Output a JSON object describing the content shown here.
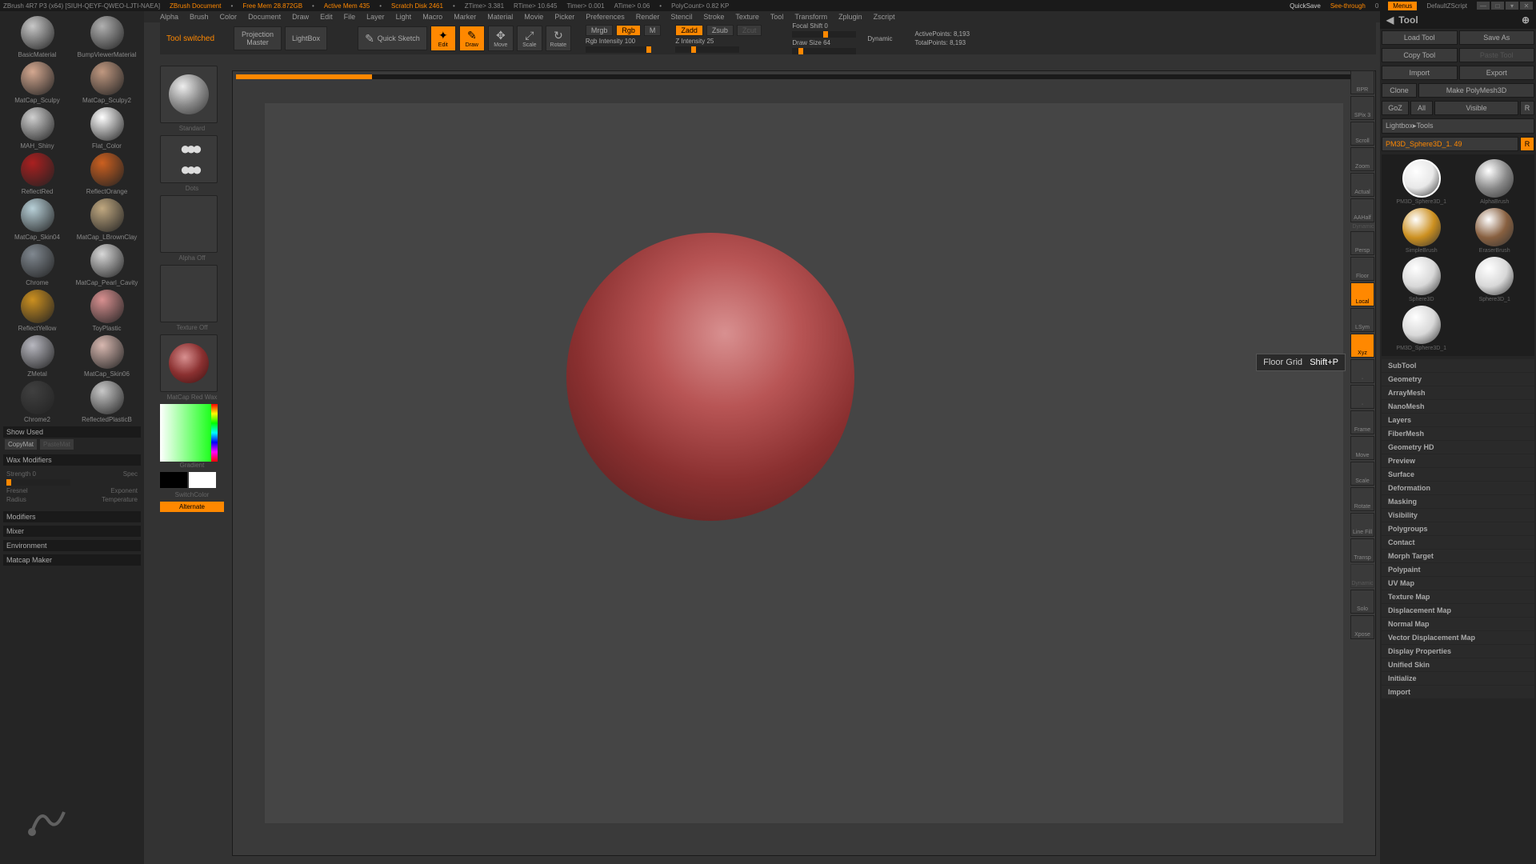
{
  "title_bar": {
    "app": "ZBrush 4R7 P3 (x64) [SIUH-QEYF-QWEO-LJTI-NAEA]",
    "doc": "ZBrush Document",
    "free_mem": "Free Mem 28.872GB",
    "active_mem": "Active Mem 435",
    "scratch": "Scratch Disk 2461",
    "ztime": "ZTime> 3.381",
    "rtime": "RTime> 10.645",
    "timer": "Timer> 0.001",
    "atime": "ATime> 0.06",
    "polycount": "PolyCount> 0.82 KP",
    "quicksave": "QuickSave",
    "seethrough": "See-through",
    "seethrough_val": "0",
    "menus": "Menus",
    "default_script": "DefaultZScript"
  },
  "menu": [
    "Alpha",
    "Brush",
    "Color",
    "Document",
    "Draw",
    "Edit",
    "File",
    "Layer",
    "Light",
    "Macro",
    "Marker",
    "Material",
    "Movie",
    "Picker",
    "Preferences",
    "Render",
    "Stencil",
    "Stroke",
    "Texture",
    "Tool",
    "Transform",
    "Zplugin",
    "Zscript"
  ],
  "toolbar": {
    "status": "Tool switched",
    "projection": "Projection Master",
    "lightbox": "LightBox",
    "quick_sketch": "Quick Sketch",
    "edit": "Edit",
    "draw": "Draw",
    "move": "Move",
    "scale": "Scale",
    "rotate": "Rotate",
    "mrgb": "Mrgb",
    "rgb": "Rgb",
    "m": "M",
    "rgb_intensity": "Rgb Intensity 100",
    "zadd": "Zadd",
    "zsub": "Zsub",
    "zcut": "Zcut",
    "z_intensity": "Z Intensity 25",
    "focal_shift": "Focal Shift 0",
    "draw_size": "Draw Size 64",
    "dynamic": "Dynamic",
    "active_points": "ActivePoints: 8,193",
    "total_points": "TotalPoints: 8,193"
  },
  "materials": [
    {
      "name": "BasicMaterial",
      "color": "#c8c8c8"
    },
    {
      "name": "BumpViewerMaterial",
      "color": "#b0b0b0"
    },
    {
      "name": "MatCap_Sculpy",
      "color": "#d4a890"
    },
    {
      "name": "MatCap_Sculpy2",
      "color": "#c09880"
    },
    {
      "name": "MAH_Shiny",
      "color": "#d0d0d0"
    },
    {
      "name": "Flat_Color",
      "color": "#ffffff"
    },
    {
      "name": "ReflectRed",
      "color": "#aa2020"
    },
    {
      "name": "ReflectOrange",
      "color": "#cc6020"
    },
    {
      "name": "MatCap_Skin04",
      "color": "#b8d0d8"
    },
    {
      "name": "MatCap_LBrownClay",
      "color": "#c0a880"
    },
    {
      "name": "Chrome",
      "color": "#808890"
    },
    {
      "name": "MatCap_Pearl_Cavity",
      "color": "#d8d8d8"
    },
    {
      "name": "ReflectYellow",
      "color": "#cc9020"
    },
    {
      "name": "ToyPlastic",
      "color": "#d89090"
    },
    {
      "name": "ZMetal",
      "color": "#b8b8c0"
    },
    {
      "name": "MatCap_Skin06",
      "color": "#d8b8b0"
    },
    {
      "name": "Chrome2",
      "color": "#404040"
    },
    {
      "name": "ReflectedPlasticB",
      "color": "#c8c8c8"
    }
  ],
  "mat_section": {
    "show_used": "Show Used",
    "copy": "CopyMat",
    "paste": "PasteMat",
    "wax_hdr": "Wax Modifiers",
    "strength": "Strength 0",
    "spec": "Spec",
    "fresnel": "Fresnel",
    "exponent": "Exponent",
    "radius": "Radius",
    "temperature": "Temperature",
    "modifiers": "Modifiers",
    "mixer": "Mixer",
    "environment": "Environment",
    "matcap_maker": "Matcap Maker"
  },
  "brush": {
    "standard": "Standard",
    "dots": "Dots",
    "alpha_off": "Alpha Off",
    "texture_off": "Texture Off",
    "current_mat": "MatCap Red Wax",
    "gradient": "Gradient",
    "switch": "SwitchColor",
    "alternate": "Alternate"
  },
  "right_nav": [
    {
      "label": "BPR",
      "active": false
    },
    {
      "label": "SPix 3",
      "active": false,
      "text_only": true
    },
    {
      "label": "Scroll",
      "active": false
    },
    {
      "label": "Zoom",
      "active": false
    },
    {
      "label": "Actual",
      "active": false
    },
    {
      "label": "AAHalf",
      "active": false
    },
    {
      "label": "Persp",
      "active": false,
      "dynamic": "Dynamic"
    },
    {
      "label": "Floor",
      "active": false
    },
    {
      "label": "Local",
      "active": true
    },
    {
      "label": "LSym",
      "active": false
    },
    {
      "label": "Xyz",
      "active": true
    },
    {
      "label": "·",
      "active": false
    },
    {
      "label": "·",
      "active": false
    },
    {
      "label": "Frame",
      "active": false
    },
    {
      "label": "Move",
      "active": false
    },
    {
      "label": "Scale",
      "active": false
    },
    {
      "label": "Rotate",
      "active": false
    },
    {
      "label": "Line Fill",
      "active": false
    },
    {
      "label": "Transp",
      "active": false
    },
    {
      "label": "Dynamic",
      "active": false,
      "dim": true
    },
    {
      "label": "Solo",
      "active": false
    },
    {
      "label": "Xpose",
      "active": false
    }
  ],
  "tooltip": {
    "text": "Floor Grid",
    "shortcut": "Shift+P"
  },
  "tool_panel": {
    "title": "Tool",
    "load": "Load Tool",
    "save": "Save As",
    "copy": "Copy Tool",
    "paste": "Paste Tool",
    "import": "Import",
    "export": "Export",
    "clone": "Clone",
    "make_poly": "Make PolyMesh3D",
    "goz": "GoZ",
    "all": "All",
    "visible": "Visible",
    "r": "R",
    "lightbox_tools": "Lightbox▸Tools",
    "current": "PM3D_Sphere3D_1. 49",
    "tools": [
      {
        "name": "PM3D_Sphere3D_1",
        "color": "#e8e8e8"
      },
      {
        "name": "AlphaBrush",
        "color": "#888"
      },
      {
        "name": "SimpleBrush",
        "color": "#cc9020"
      },
      {
        "name": "EraserBrush",
        "color": "#886040"
      },
      {
        "name": "Sphere3D",
        "color": "#d8d8d8"
      },
      {
        "name": "Sphere3D_1",
        "color": "#d8d8d8"
      },
      {
        "name": "PM3D_Sphere3D_1",
        "color": "#d8d8d8"
      }
    ],
    "sections": [
      "SubTool",
      "Geometry",
      "ArrayMesh",
      "NanoMesh",
      "Layers",
      "FiberMesh",
      "Geometry HD",
      "Preview",
      "Surface",
      "Deformation",
      "Masking",
      "Visibility",
      "Polygroups",
      "Contact",
      "Morph Target",
      "Polypaint",
      "UV Map",
      "Texture Map",
      "Displacement Map",
      "Normal Map",
      "Vector Displacement Map",
      "Display Properties",
      "Unified Skin",
      "Initialize",
      "Import"
    ]
  }
}
